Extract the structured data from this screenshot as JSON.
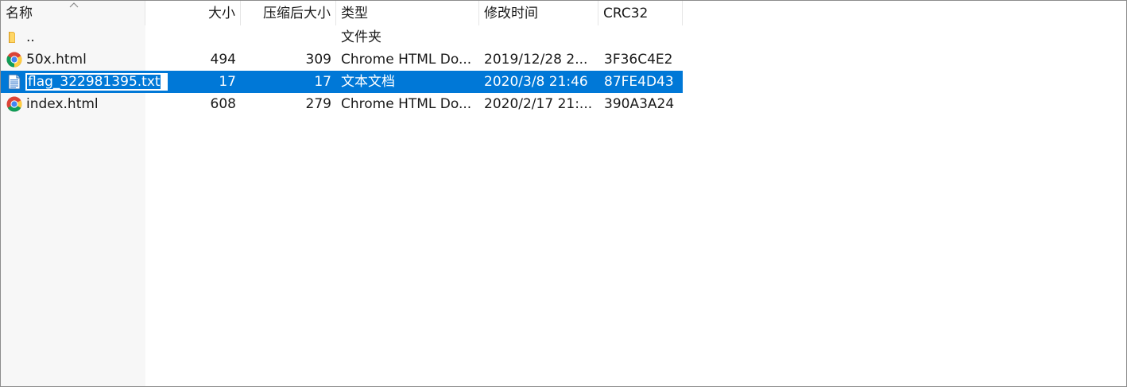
{
  "columns": {
    "name": "名称",
    "size": "大小",
    "packed": "压缩后大小",
    "type": "类型",
    "modified": "修改时间",
    "crc": "CRC32"
  },
  "files": [
    {
      "name": "..",
      "size": "",
      "packed": "",
      "type": "文件夹",
      "modified": "",
      "crc": "",
      "icon": "folder-icon"
    },
    {
      "name": "50x.html",
      "size": "494",
      "packed": "309",
      "type": "Chrome HTML Do...",
      "modified": "2019/12/28 2...",
      "crc": "3F36C4E2",
      "icon": "chrome-icon"
    },
    {
      "name": "flag_322981395.txt",
      "size": "17",
      "packed": "17",
      "type": "文本文档",
      "modified": "2020/3/8 21:46",
      "crc": "87FE4D43",
      "icon": "text-file-icon",
      "selected": true,
      "renaming": true
    },
    {
      "name": "index.html",
      "size": "608",
      "packed": "279",
      "type": "Chrome HTML Do...",
      "modified": "2020/2/17 21:...",
      "crc": "390A3A24",
      "icon": "chrome-icon"
    }
  ],
  "colors": {
    "selection": "#0078d7",
    "name_column_bg": "#f7f7f7"
  }
}
